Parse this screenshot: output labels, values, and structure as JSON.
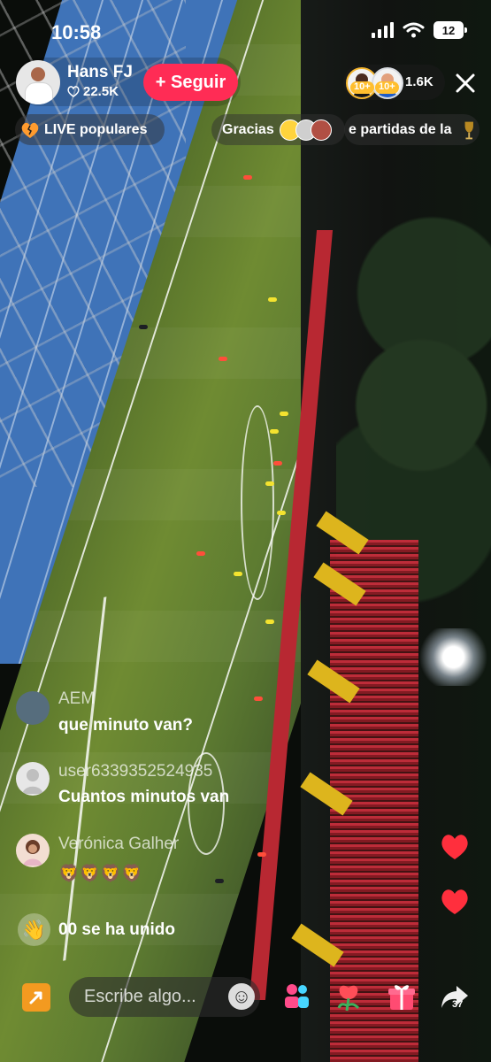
{
  "status_bar": {
    "time": "10:58",
    "battery": "12"
  },
  "host": {
    "name": "Hans FJ",
    "likes": "22.5K",
    "follow_label": "+ Seguir"
  },
  "viewers": {
    "count": "1.6K",
    "badges": [
      "10+",
      "10+"
    ]
  },
  "top_pills": [
    "LIVE populares",
    "Gracias",
    "e partidas de la"
  ],
  "comments": [
    {
      "user": "AEM",
      "message": "que minuto van?"
    },
    {
      "user": "user6339352524935",
      "message": "Cuantos minutos van"
    },
    {
      "user": "Verónica Galher",
      "message": "🦁🦁🦁🦁"
    }
  ],
  "join_message": "00 se ha unido",
  "input": {
    "placeholder": "Escribe algo..."
  },
  "share_count": "37",
  "icons": [
    "battery-icon",
    "signal-icon",
    "wifi-icon",
    "heart-icon",
    "close-icon",
    "broken-heart-icon",
    "trophy-icon",
    "share-icon",
    "emoji-icon",
    "multi-guest-icon",
    "rose-icon",
    "gift-icon",
    "forward-icon"
  ],
  "colors": {
    "accent": "#ff2c55",
    "share_orange": "#f39a20",
    "heart": "#ff2f3d"
  }
}
